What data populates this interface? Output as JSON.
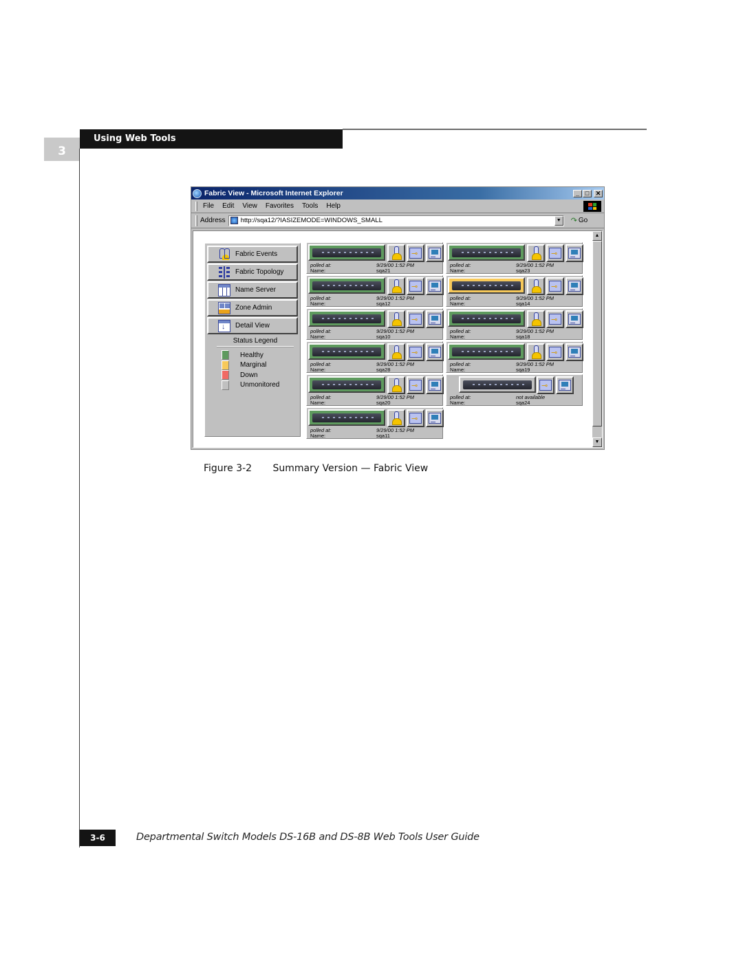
{
  "page": {
    "chapter_number": "3",
    "section_header": "Using Web Tools",
    "page_number": "3-6",
    "footer_title": "Departmental Switch Models DS-16B and DS-8B Web Tools User Guide",
    "figure": {
      "number": "Figure 3-2",
      "caption": "Summary Version — Fabric View"
    }
  },
  "browser": {
    "title": "Fabric View - Microsoft Internet Explorer",
    "window_buttons": {
      "minimize": "_",
      "maximize": "□",
      "close": "✕"
    },
    "menu": [
      {
        "label": "File",
        "accel": "F"
      },
      {
        "label": "Edit",
        "accel": "E"
      },
      {
        "label": "View",
        "accel": "V"
      },
      {
        "label": "Favorites",
        "accel": "a"
      },
      {
        "label": "Tools",
        "accel": "T"
      },
      {
        "label": "Help",
        "accel": "H"
      }
    ],
    "address_label": "Address",
    "address_value": "http://sqa12/?IASIZEMODE=WINDOWS_SMALL",
    "go_label": "Go"
  },
  "nav": {
    "buttons": [
      {
        "label": "Fabric Events",
        "icon": "fabric-events-icon"
      },
      {
        "label": "Fabric Topology",
        "icon": "fabric-topology-icon"
      },
      {
        "label": "Name Server",
        "icon": "name-server-icon"
      },
      {
        "label": "Zone Admin",
        "icon": "zone-admin-icon"
      },
      {
        "label": "Detail View",
        "icon": "detail-view-icon"
      }
    ],
    "legend": {
      "title": "Status Legend",
      "items": [
        {
          "label": "Healthy",
          "color": "#5e9a5e"
        },
        {
          "label": "Marginal",
          "color": "#f7c95a"
        },
        {
          "label": "Down",
          "color": "#f06a64"
        },
        {
          "label": "Unmonitored",
          "color": "#c0c0c0"
        }
      ]
    }
  },
  "status_colors": {
    "healthy": "#5e9a5e",
    "marginal": "#f7c95a",
    "down": "#f06a64",
    "unmonitored": "#c0c0c0"
  },
  "switch_labels": {
    "polled": "polled at:",
    "name": "Name:"
  },
  "switches": [
    {
      "name": "sqa21",
      "polled": "9/29/00 1:52 PM",
      "status": "healthy"
    },
    {
      "name": "sqa23",
      "polled": "9/29/00 1:52 PM",
      "status": "healthy"
    },
    {
      "name": "sqa12",
      "polled": "9/29/00 1:52 PM",
      "status": "healthy"
    },
    {
      "name": "sqa14",
      "polled": "9/29/00 1:52 PM",
      "status": "marginal"
    },
    {
      "name": "sqa10",
      "polled": "9/29/00 1:52 PM",
      "status": "healthy"
    },
    {
      "name": "sqa18",
      "polled": "9/29/00 1:52 PM",
      "status": "healthy"
    },
    {
      "name": "sqa28",
      "polled": "9/29/00 1:52 PM",
      "status": "healthy"
    },
    {
      "name": "sqa19",
      "polled": "9/29/00 1:52 PM",
      "status": "healthy"
    },
    {
      "name": "sqa20",
      "polled": "9/29/00 1:52 PM",
      "status": "healthy"
    },
    {
      "name": "sqa24",
      "polled": "not available",
      "status": "unmonitored"
    },
    {
      "name": "sqa11",
      "polled": "9/29/00 1:52 PM",
      "status": "healthy"
    }
  ]
}
